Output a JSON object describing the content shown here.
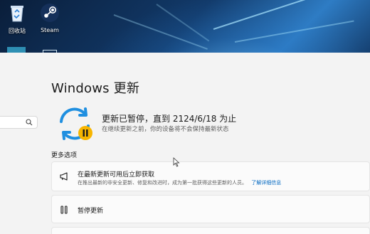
{
  "desktop": {
    "icons": [
      {
        "label": "回收站",
        "icon": "recycle-bin-icon"
      },
      {
        "label": "Steam",
        "icon": "steam-icon"
      }
    ]
  },
  "settings": {
    "page_title": "Windows 更新",
    "status": {
      "title": "更新已暂停，直到 2124/6/18 为止",
      "subtitle": "在继续更新之前，你的设备将不会保持最新状态",
      "icon": "update-paused-icon"
    },
    "more_options_label": "更多选项",
    "options": [
      {
        "title": "在最新更新可用后立即获取",
        "description": "在推出最新的非安全更新、修复和改进时，成为第一批获得这些更新的人员。",
        "link": "了解详细信息",
        "icon": "megaphone-icon"
      },
      {
        "title": "暂停更新",
        "icon": "pause-icon"
      }
    ]
  },
  "colors": {
    "accent": "#0067c0",
    "sync_blue": "#1f8fe0",
    "pause_badge": "#f7b500"
  }
}
